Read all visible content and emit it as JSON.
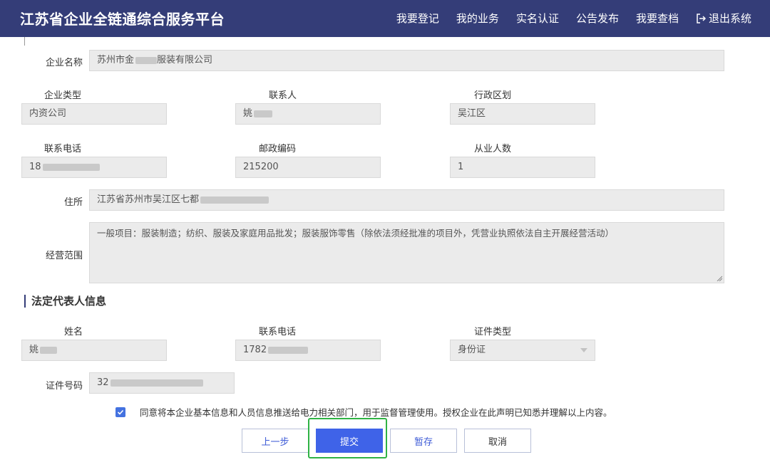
{
  "header": {
    "title": "江苏省企业全链通综合服务平台",
    "nav": [
      "我要登记",
      "我的业务",
      "实名认证",
      "公告发布",
      "我要查档"
    ],
    "logout": "退出系统"
  },
  "company": {
    "name_label": "企业名称",
    "name_value_a": "苏州市金",
    "name_value_b": "服装有限公司",
    "type_label": "企业类型",
    "type_value": "内资公司",
    "contact_label": "联系人",
    "contact_value": "姚",
    "region_label": "行政区划",
    "region_value": "吴江区",
    "phone_label": "联系电话",
    "phone_value": "18",
    "postcode_label": "邮政编码",
    "postcode_value": "215200",
    "staff_label": "从业人数",
    "staff_value": "1",
    "address_label": "住所",
    "address_value": "江苏省苏州市吴江区七都",
    "scope_label": "经营范围",
    "scope_value": "一般项目：服装制造；纺织、服装及家庭用品批发；服装服饰零售（除依法须经批准的项目外，凭营业执照依法自主开展经营活动）"
  },
  "legal": {
    "section_title": "法定代表人信息",
    "name_label": "姓名",
    "name_value": "姚",
    "phone_label": "联系电话",
    "phone_value": "1782",
    "idtype_label": "证件类型",
    "idtype_value": "身份证",
    "idno_label": "证件号码",
    "idno_value": "32"
  },
  "agreement": {
    "text": "同意将本企业基本信息和人员信息推送给电力相关部门，用于监督管理使用。授权企业在此声明已知悉并理解以上内容。",
    "checked": true
  },
  "buttons": {
    "prev": "上一步",
    "submit": "提交",
    "save": "暂存",
    "cancel": "取消"
  },
  "colors": {
    "header_bg": "#343d78",
    "primary": "#3f63e8",
    "highlight": "#2fb344"
  }
}
